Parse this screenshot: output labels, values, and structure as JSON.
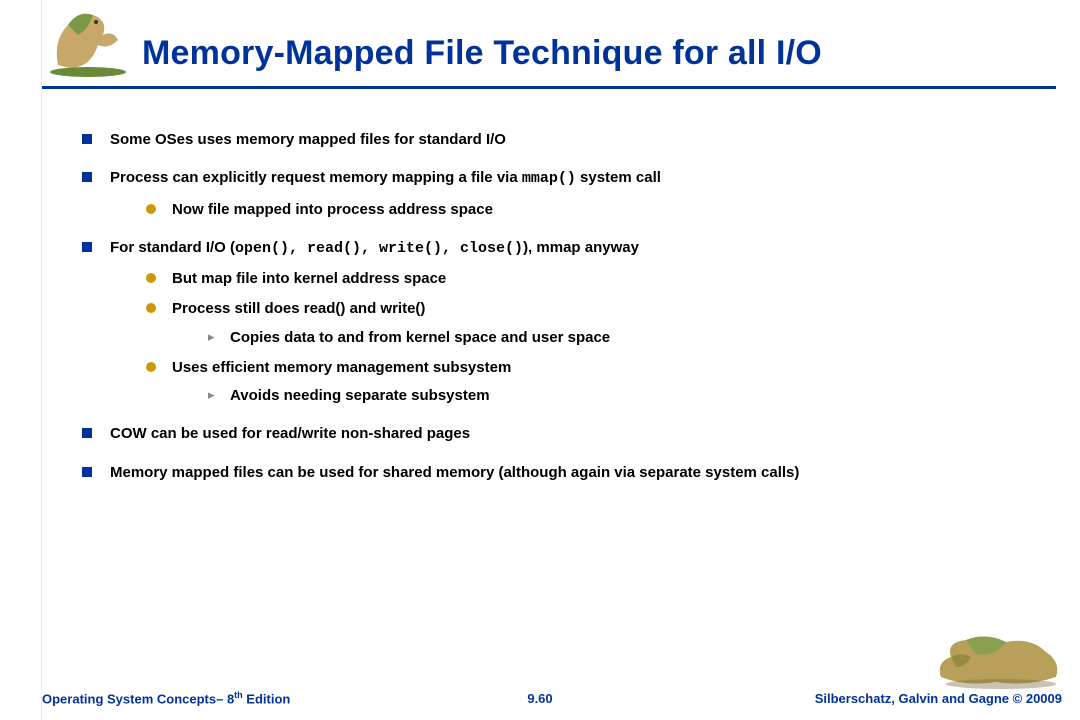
{
  "title": "Memory-Mapped File Technique for all I/O",
  "bullets": {
    "b1": "Some OSes  uses memory mapped files for standard I/O",
    "b2_a": "Process can explicitly request memory mapping a file via ",
    "b2_code": "mmap()",
    "b2_b": " system call",
    "b2_s1": "Now file mapped into process address space",
    "b3_a": "For standard I/O (",
    "b3_code": "open(), read(), write(), close()",
    "b3_b": "), mmap anyway",
    "b3_s1": "But map file into kernel address space",
    "b3_s2": "Process still does read() and write()",
    "b3_s2_t1": "Copies data to and from kernel space and user space",
    "b3_s3": "Uses efficient memory management subsystem",
    "b3_s3_t1": "Avoids needing separate subsystem",
    "b4": "COW can be used for read/write non-shared pages",
    "b5": "Memory mapped files can be  used for shared memory (although again via separate system calls)"
  },
  "footer": {
    "left_a": "Operating System Concepts– 8",
    "left_sup": "th",
    "left_b": " Edition",
    "center": "9.60",
    "right": "Silberschatz, Galvin and Gagne © 20009"
  }
}
